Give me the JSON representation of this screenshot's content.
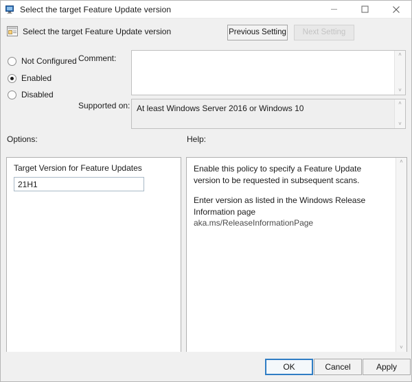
{
  "window": {
    "title": "Select the target Feature Update version",
    "icon": "monitor-icon",
    "minimize_label": "—",
    "maximize_label": "□",
    "close_label": "✕"
  },
  "header": {
    "title": "Select the target Feature Update version",
    "icon": "policy-setting-icon",
    "previous_setting_label": "Previous Setting",
    "next_setting_label": "Next Setting",
    "next_setting_enabled": false
  },
  "state": {
    "options": [
      {
        "label": "Not Configured",
        "selected": false
      },
      {
        "label": "Enabled",
        "selected": true
      },
      {
        "label": "Disabled",
        "selected": false
      }
    ]
  },
  "comment": {
    "label": "Comment:",
    "value": "",
    "scroll_up": "˄",
    "scroll_down": "˅"
  },
  "supported_on": {
    "label": "Supported on:",
    "value": "At least Windows Server 2016 or Windows 10",
    "scroll_up": "˄",
    "scroll_down": "˅"
  },
  "options_panel": {
    "section_label": "Options:",
    "field_label": "Target Version for Feature Updates",
    "field_value": "21H1"
  },
  "help_panel": {
    "section_label": "Help:",
    "paragraph_1": "Enable this policy to specify a Feature Update version to be requested in subsequent scans.",
    "paragraph_2": "Enter version as listed in the Windows Release Information page",
    "link_text": "aka.ms/ReleaseInformationPage",
    "scroll_up": "˄",
    "scroll_down": "˅"
  },
  "footer": {
    "ok_label": "OK",
    "cancel_label": "Cancel",
    "apply_label": "Apply"
  },
  "colors": {
    "accent": "#2f7dc4",
    "dialog_bg": "#f0f0f0",
    "panel_bg": "#ffffff"
  }
}
